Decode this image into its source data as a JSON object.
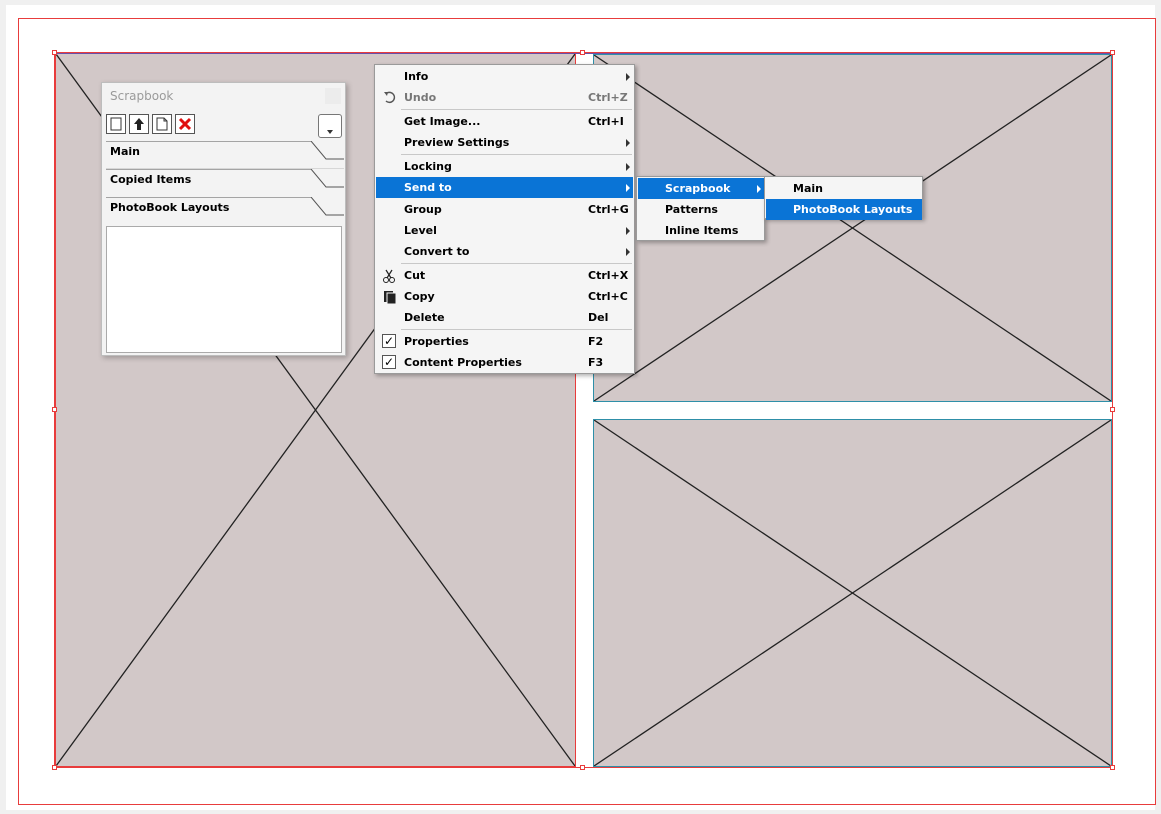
{
  "colors": {
    "frame_fill": "#d2c8c8",
    "selection": "#e83c3c",
    "frame_border": "#2e8fa8",
    "menu_highlight": "#0a74d6"
  },
  "scrapbook": {
    "title": "Scrapbook",
    "toolbar_icons": [
      "new-page-icon",
      "up-arrow-icon",
      "document-icon",
      "delete-x-icon"
    ],
    "tabs": [
      "Main",
      "Copied Items",
      "PhotoBook Layouts"
    ]
  },
  "context_menu": {
    "items": {
      "info": "Info",
      "undo": "Undo",
      "undo_shortcut": "Ctrl+Z",
      "get_image": "Get Image...",
      "get_image_shortcut": "Ctrl+I",
      "preview_settings": "Preview Settings",
      "locking": "Locking",
      "send_to": "Send to",
      "group": "Group",
      "group_shortcut": "Ctrl+G",
      "level": "Level",
      "convert_to": "Convert to",
      "cut": "Cut",
      "cut_shortcut": "Ctrl+X",
      "copy": "Copy",
      "copy_shortcut": "Ctrl+C",
      "delete": "Delete",
      "delete_shortcut": "Del",
      "properties": "Properties",
      "properties_shortcut": "F2",
      "content_properties": "Content Properties",
      "content_properties_shortcut": "F3"
    }
  },
  "send_to_submenu": {
    "scrapbook": "Scrapbook",
    "patterns": "Patterns",
    "inline_items": "Inline Items"
  },
  "scrapbook_submenu": {
    "main": "Main",
    "photobook_layouts": "PhotoBook Layouts"
  }
}
